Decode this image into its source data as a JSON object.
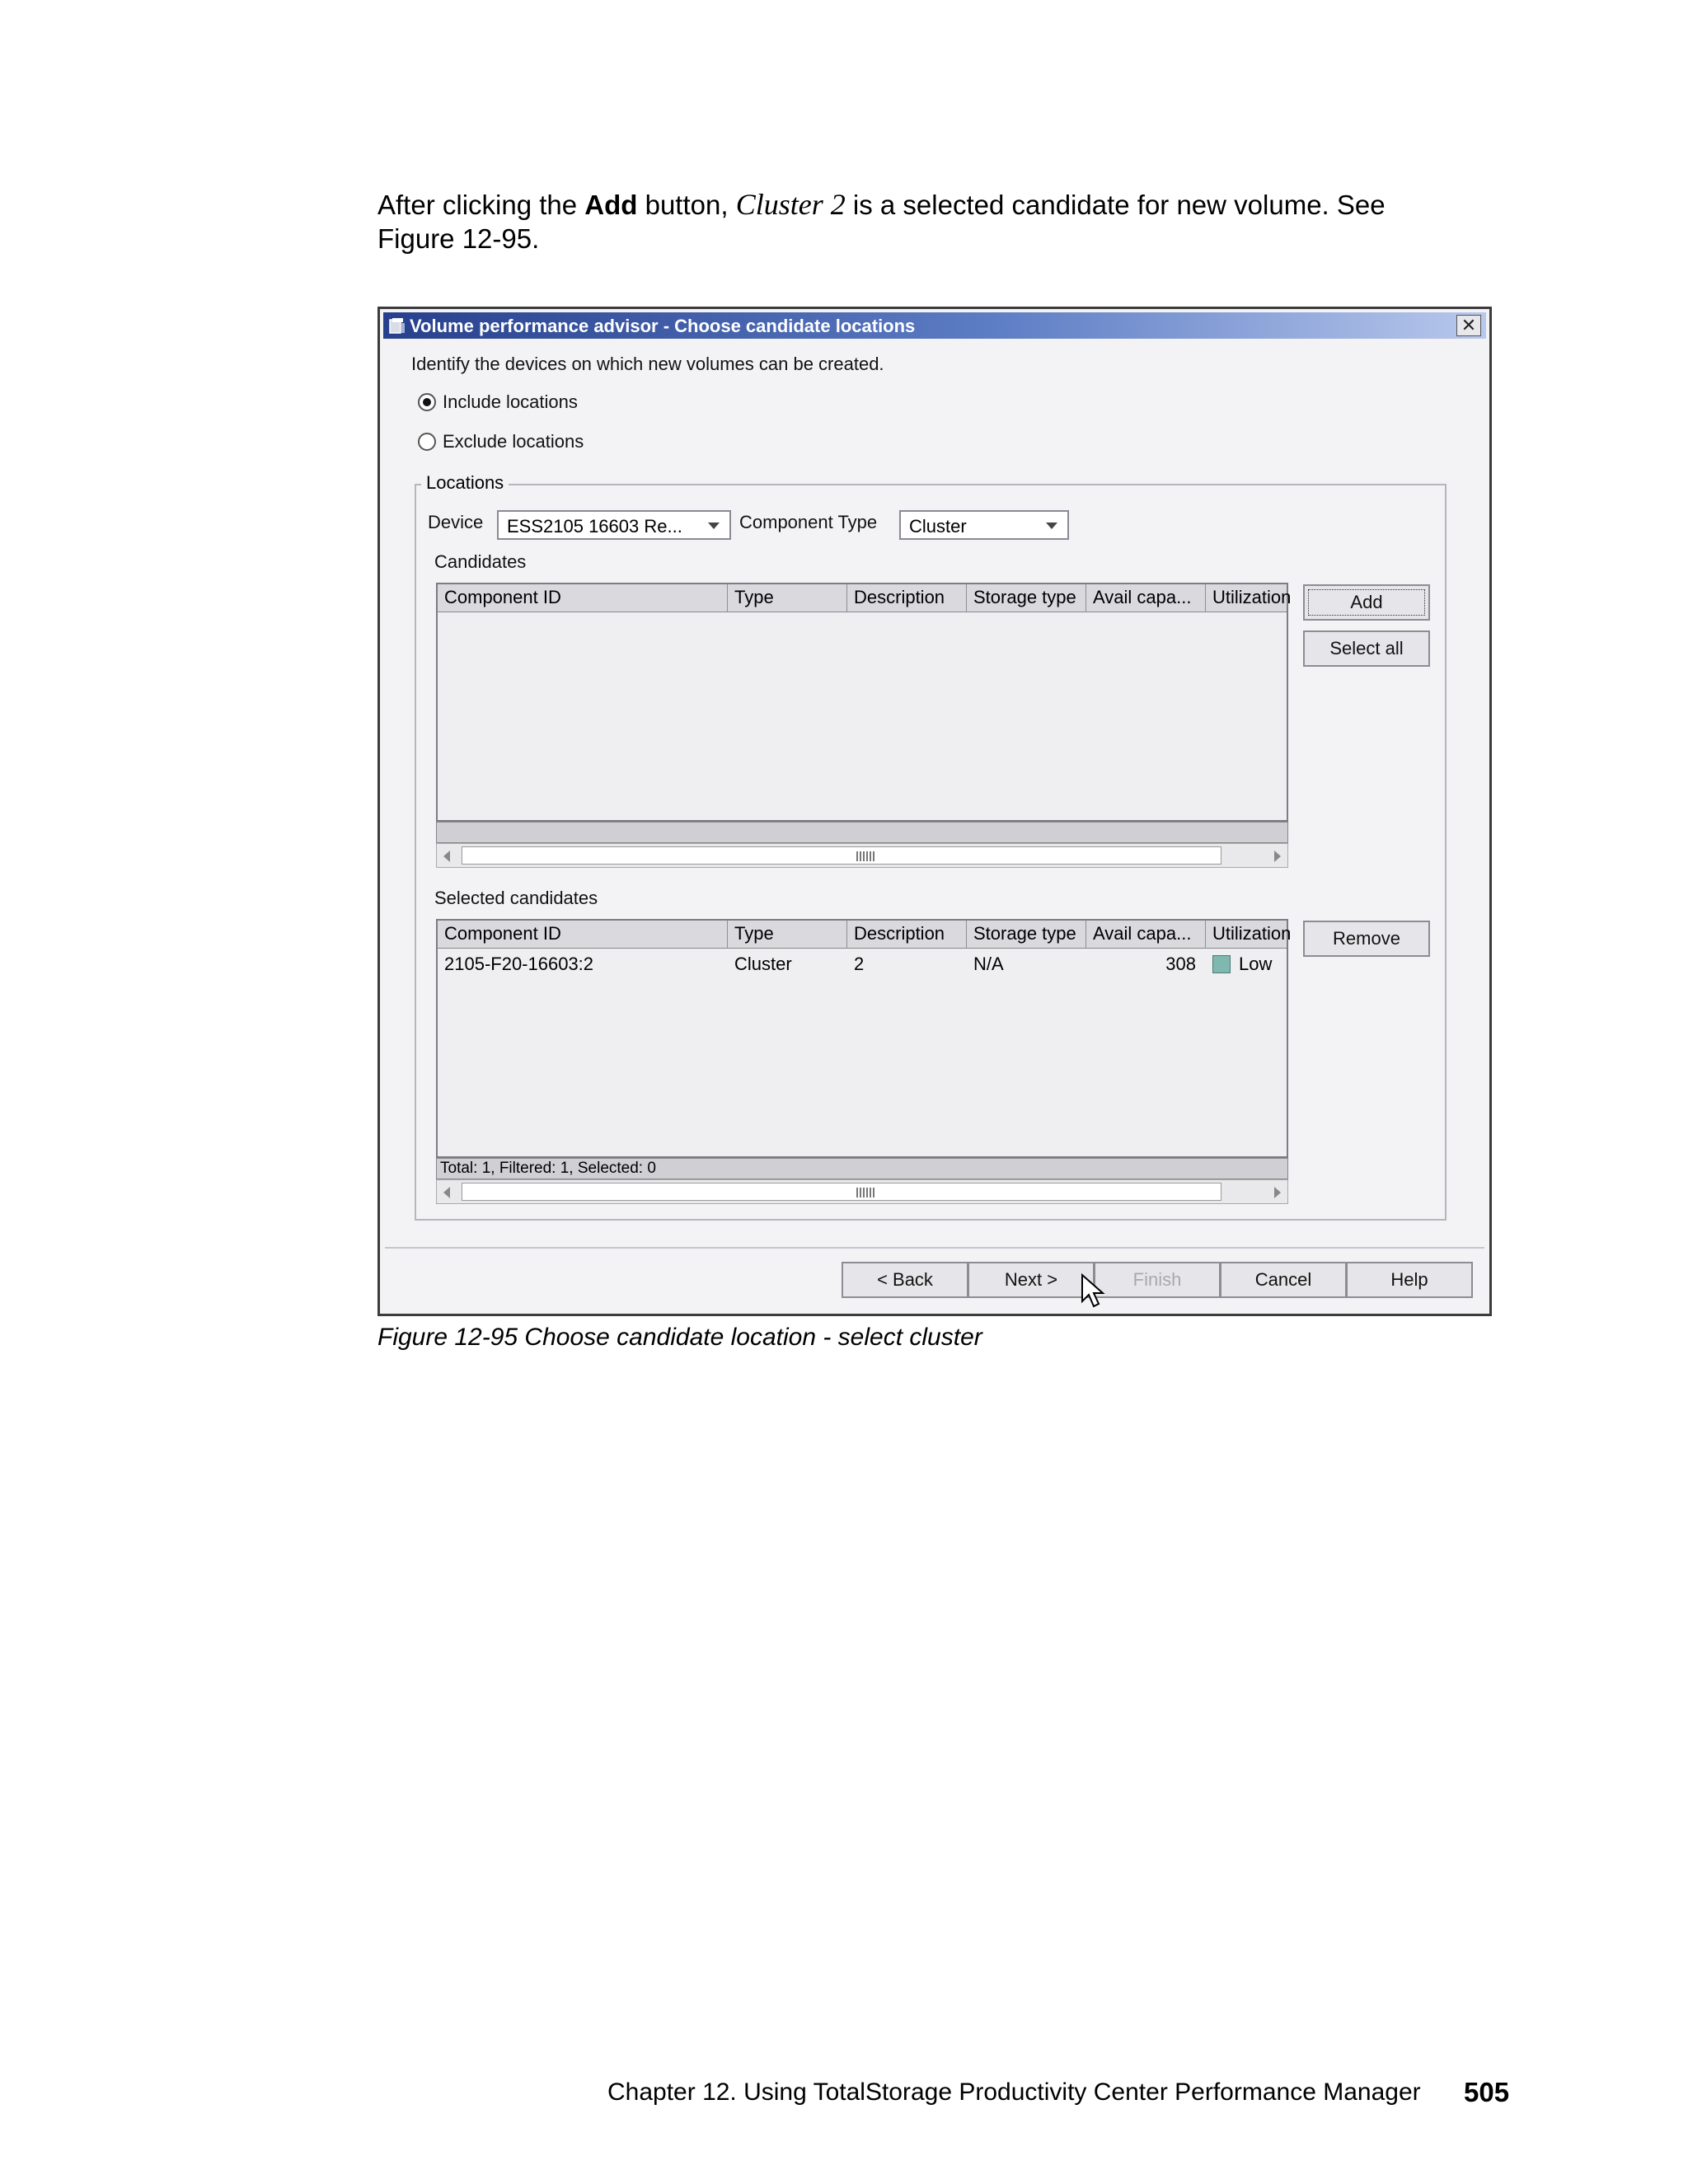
{
  "intro": {
    "part1": "After clicking the ",
    "bold": "Add",
    "part2": " button, ",
    "italic": "Cluster 2",
    "part3": " is a selected candidate for new volume. See Figure 12-95."
  },
  "dialog": {
    "title": "Volume performance advisor - Choose candidate locations",
    "close_glyph": "✕",
    "instruction": "Identify the devices on which new volumes can be created.",
    "radio_include": "Include locations",
    "radio_exclude": "Exclude locations",
    "include_selected": true,
    "locations_legend": "Locations",
    "device_label": "Device",
    "device_value": "ESS2105 16603 Re...",
    "component_type_label": "Component Type",
    "component_type_value": "Cluster",
    "candidates_label": "Candidates",
    "columns": [
      "Component ID",
      "Type",
      "Description",
      "Storage type",
      "Avail capa...",
      "Utilization"
    ],
    "candidates_rows": [],
    "add_button": "Add",
    "select_all_button": "Select all",
    "selected_label": "Selected candidates",
    "selected_rows": [
      {
        "component_id": "2105-F20-16603:2",
        "type": "Cluster",
        "description": "2",
        "storage_type": "N/A",
        "avail_capacity": "308",
        "utilization": "Low"
      }
    ],
    "remove_button": "Remove",
    "selected_status": "Total: 1, Filtered: 1, Selected: 0",
    "footer_buttons": {
      "back": "< Back",
      "next": "Next >",
      "finish": "Finish",
      "cancel": "Cancel",
      "help": "Help"
    }
  },
  "caption": "Figure 12-95   Choose candidate location - select cluster",
  "footer": {
    "chapter": "Chapter 12. Using TotalStorage Productivity Center Performance Manager",
    "page": "505"
  },
  "colors": {
    "titlebar_start": "#27408d",
    "titlebar_end": "#b8c8ec",
    "utilization_low": "#7fb8ae"
  },
  "icons": [
    "volume-advisor-app-icon",
    "close-icon",
    "dropdown-arrow-icon",
    "scroll-left-icon",
    "scroll-right-icon",
    "mouse-pointer-icon"
  ]
}
